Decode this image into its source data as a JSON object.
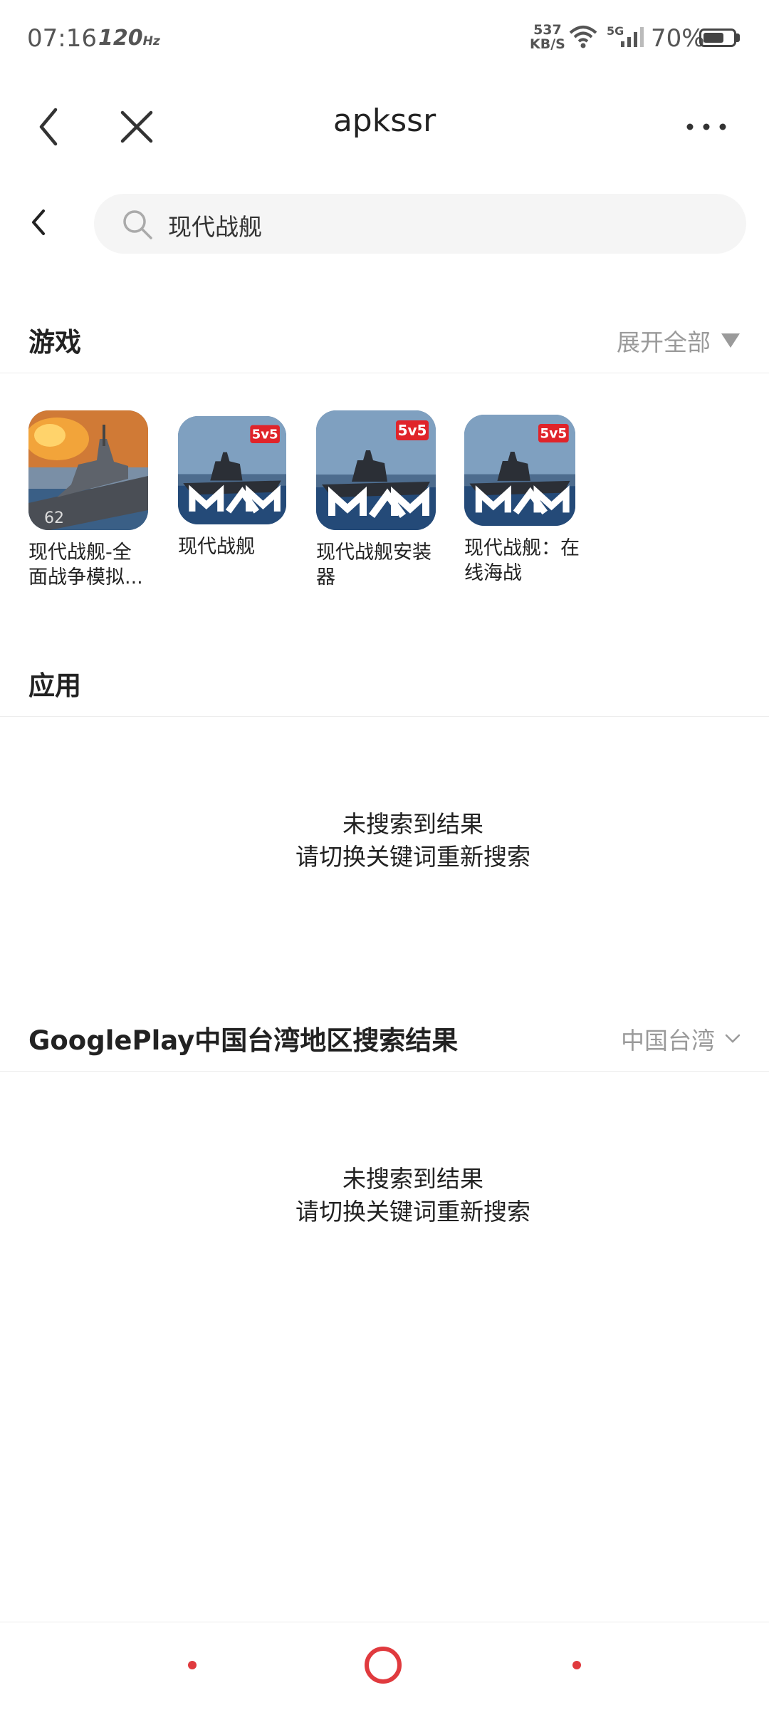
{
  "status_bar": {
    "time": "07:16",
    "refresh_rate": "120",
    "refresh_unit": "Hz",
    "net_speed_value": "537",
    "net_speed_unit": "KB/S",
    "network_type": "5G",
    "battery_text": "70%",
    "battery_level": 0.7
  },
  "header": {
    "title": "apkssr",
    "icons": [
      "back-icon",
      "close-icon",
      "more-icon"
    ]
  },
  "search": {
    "query": "现代战舰"
  },
  "games_section": {
    "title": "游戏",
    "expand_label": "展开全部",
    "items": [
      {
        "name": "现代战舰-全面战争模拟..."
      },
      {
        "name": "现代战舰",
        "badge": "5v5"
      },
      {
        "name": "现代战舰安装器",
        "badge": "5v5"
      },
      {
        "name": "现代战舰：在线海战",
        "badge": "5v5"
      }
    ]
  },
  "apps_section": {
    "title": "应用",
    "empty_line1": "未搜索到结果",
    "empty_line2": "请切换关键词重新搜索"
  },
  "googleplay_section": {
    "title": "GooglePlay中国台湾地区搜索结果",
    "region": "中国台湾",
    "empty_line1": "未搜索到结果",
    "empty_line2": "请切换关键词重新搜索"
  },
  "colors": {
    "accent": "#e03a3e",
    "muted_text": "#9a9a9a",
    "search_bg": "#f5f5f5"
  }
}
